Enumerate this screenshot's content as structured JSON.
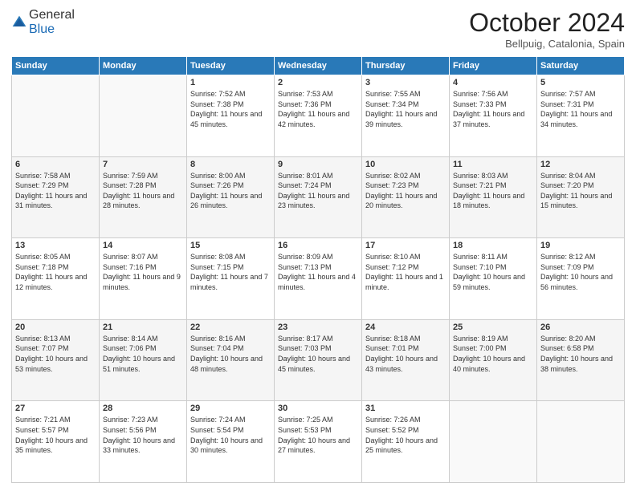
{
  "header": {
    "logo_general": "General",
    "logo_blue": "Blue",
    "month": "October 2024",
    "location": "Bellpuig, Catalonia, Spain"
  },
  "days_of_week": [
    "Sunday",
    "Monday",
    "Tuesday",
    "Wednesday",
    "Thursday",
    "Friday",
    "Saturday"
  ],
  "weeks": [
    [
      {
        "day": "",
        "info": ""
      },
      {
        "day": "",
        "info": ""
      },
      {
        "day": "1",
        "info": "Sunrise: 7:52 AM\nSunset: 7:38 PM\nDaylight: 11 hours and 45 minutes."
      },
      {
        "day": "2",
        "info": "Sunrise: 7:53 AM\nSunset: 7:36 PM\nDaylight: 11 hours and 42 minutes."
      },
      {
        "day": "3",
        "info": "Sunrise: 7:55 AM\nSunset: 7:34 PM\nDaylight: 11 hours and 39 minutes."
      },
      {
        "day": "4",
        "info": "Sunrise: 7:56 AM\nSunset: 7:33 PM\nDaylight: 11 hours and 37 minutes."
      },
      {
        "day": "5",
        "info": "Sunrise: 7:57 AM\nSunset: 7:31 PM\nDaylight: 11 hours and 34 minutes."
      }
    ],
    [
      {
        "day": "6",
        "info": "Sunrise: 7:58 AM\nSunset: 7:29 PM\nDaylight: 11 hours and 31 minutes."
      },
      {
        "day": "7",
        "info": "Sunrise: 7:59 AM\nSunset: 7:28 PM\nDaylight: 11 hours and 28 minutes."
      },
      {
        "day": "8",
        "info": "Sunrise: 8:00 AM\nSunset: 7:26 PM\nDaylight: 11 hours and 26 minutes."
      },
      {
        "day": "9",
        "info": "Sunrise: 8:01 AM\nSunset: 7:24 PM\nDaylight: 11 hours and 23 minutes."
      },
      {
        "day": "10",
        "info": "Sunrise: 8:02 AM\nSunset: 7:23 PM\nDaylight: 11 hours and 20 minutes."
      },
      {
        "day": "11",
        "info": "Sunrise: 8:03 AM\nSunset: 7:21 PM\nDaylight: 11 hours and 18 minutes."
      },
      {
        "day": "12",
        "info": "Sunrise: 8:04 AM\nSunset: 7:20 PM\nDaylight: 11 hours and 15 minutes."
      }
    ],
    [
      {
        "day": "13",
        "info": "Sunrise: 8:05 AM\nSunset: 7:18 PM\nDaylight: 11 hours and 12 minutes."
      },
      {
        "day": "14",
        "info": "Sunrise: 8:07 AM\nSunset: 7:16 PM\nDaylight: 11 hours and 9 minutes."
      },
      {
        "day": "15",
        "info": "Sunrise: 8:08 AM\nSunset: 7:15 PM\nDaylight: 11 hours and 7 minutes."
      },
      {
        "day": "16",
        "info": "Sunrise: 8:09 AM\nSunset: 7:13 PM\nDaylight: 11 hours and 4 minutes."
      },
      {
        "day": "17",
        "info": "Sunrise: 8:10 AM\nSunset: 7:12 PM\nDaylight: 11 hours and 1 minute."
      },
      {
        "day": "18",
        "info": "Sunrise: 8:11 AM\nSunset: 7:10 PM\nDaylight: 10 hours and 59 minutes."
      },
      {
        "day": "19",
        "info": "Sunrise: 8:12 AM\nSunset: 7:09 PM\nDaylight: 10 hours and 56 minutes."
      }
    ],
    [
      {
        "day": "20",
        "info": "Sunrise: 8:13 AM\nSunset: 7:07 PM\nDaylight: 10 hours and 53 minutes."
      },
      {
        "day": "21",
        "info": "Sunrise: 8:14 AM\nSunset: 7:06 PM\nDaylight: 10 hours and 51 minutes."
      },
      {
        "day": "22",
        "info": "Sunrise: 8:16 AM\nSunset: 7:04 PM\nDaylight: 10 hours and 48 minutes."
      },
      {
        "day": "23",
        "info": "Sunrise: 8:17 AM\nSunset: 7:03 PM\nDaylight: 10 hours and 45 minutes."
      },
      {
        "day": "24",
        "info": "Sunrise: 8:18 AM\nSunset: 7:01 PM\nDaylight: 10 hours and 43 minutes."
      },
      {
        "day": "25",
        "info": "Sunrise: 8:19 AM\nSunset: 7:00 PM\nDaylight: 10 hours and 40 minutes."
      },
      {
        "day": "26",
        "info": "Sunrise: 8:20 AM\nSunset: 6:58 PM\nDaylight: 10 hours and 38 minutes."
      }
    ],
    [
      {
        "day": "27",
        "info": "Sunrise: 7:21 AM\nSunset: 5:57 PM\nDaylight: 10 hours and 35 minutes."
      },
      {
        "day": "28",
        "info": "Sunrise: 7:23 AM\nSunset: 5:56 PM\nDaylight: 10 hours and 33 minutes."
      },
      {
        "day": "29",
        "info": "Sunrise: 7:24 AM\nSunset: 5:54 PM\nDaylight: 10 hours and 30 minutes."
      },
      {
        "day": "30",
        "info": "Sunrise: 7:25 AM\nSunset: 5:53 PM\nDaylight: 10 hours and 27 minutes."
      },
      {
        "day": "31",
        "info": "Sunrise: 7:26 AM\nSunset: 5:52 PM\nDaylight: 10 hours and 25 minutes."
      },
      {
        "day": "",
        "info": ""
      },
      {
        "day": "",
        "info": ""
      }
    ]
  ]
}
